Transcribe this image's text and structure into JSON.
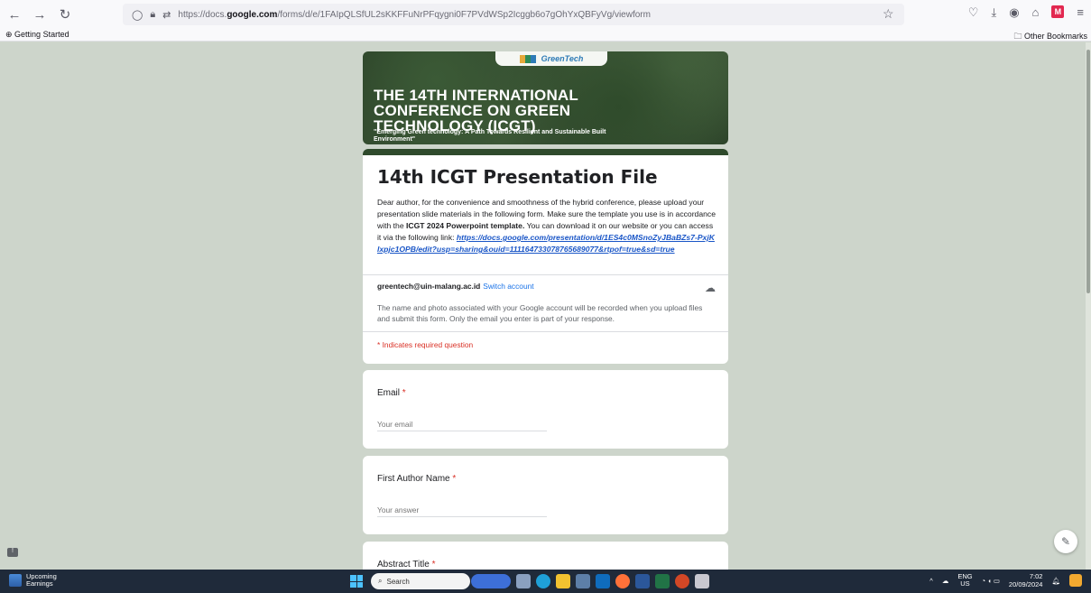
{
  "browser": {
    "url_prefix": "https://docs.",
    "url_host": "google.com",
    "url_path": "/forms/d/e/1FAIpQLSfUL2sKKFFuNrPFqygni0F7PVdWSp2Icggb6o7gOhYxQBFyVg/viewform",
    "bookmark_left": "Getting Started",
    "bookmark_right": "Other Bookmarks"
  },
  "banner": {
    "logo_text": "GreenTech",
    "title": "THE 14TH INTERNATIONAL CONFERENCE ON GREEN TECHNOLOGY (ICGT)",
    "subtitle": "\"Emerging Green technology: A Path Towards Resilient and Sustainable Built Environment\""
  },
  "form": {
    "title": "14th ICGT Presentation File",
    "desc_part1": "Dear author, for the convenience and smoothness of the hybrid conference, please upload your presentation slide materials in the following form. Make sure the template you use is in accordance with the ",
    "desc_bold": "ICGT 2024 Powerpoint template.",
    "desc_part2": " You can download it on our website or you can access it via the following link: ",
    "desc_link": "https://docs.google.com/presentation/d/1ES4c0MSnoZyJBaBZs7-PxjKlxpjc1OPB/edit?usp=sharing&ouid=111164733078765689077&rtpof=true&sd=true",
    "account_email": "greentech@uin-malang.ac.id",
    "switch_account": "Switch account",
    "privacy_note": "The name and photo associated with your Google account will be recorded when you upload files and submit this form. Only the email you enter is part of your response.",
    "required_note": "* Indicates required question"
  },
  "questions": [
    {
      "label": "Email",
      "placeholder": "Your email"
    },
    {
      "label": "First Author Name",
      "placeholder": "Your answer"
    },
    {
      "label": "Abstract Title",
      "placeholder": ""
    }
  ],
  "taskbar": {
    "weather_line1": "Upcoming",
    "weather_line2": "Earnings",
    "search_placeholder": "Search",
    "lang_line1": "ENG",
    "lang_line2": "US",
    "time": "7:02",
    "date": "20/09/2024"
  },
  "colors": {
    "accent": "#2f4a2c",
    "required": "#d93025",
    "link": "#1a73e8"
  }
}
